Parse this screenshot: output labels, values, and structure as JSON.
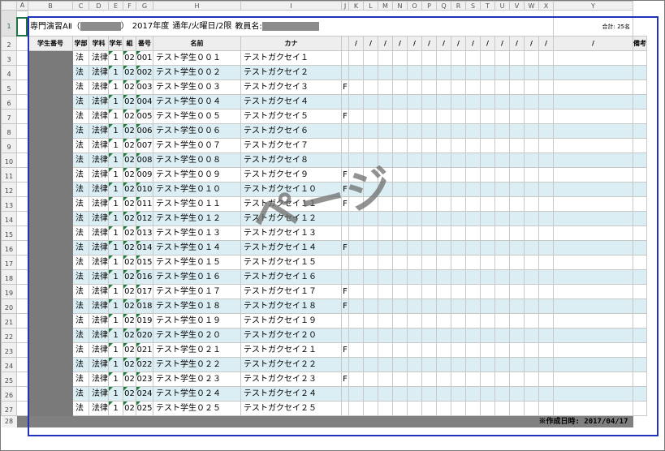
{
  "column_letters": [
    "A",
    "B",
    "C",
    "D",
    "E",
    "F",
    "G",
    "H",
    "I",
    "J",
    "K",
    "L",
    "M",
    "N",
    "O",
    "P",
    "Q",
    "R",
    "S",
    "T",
    "U",
    "V",
    "W",
    "X",
    "Y"
  ],
  "title": {
    "course": "専門演習AⅡ（",
    "course_close": "）",
    "year": "2017年度",
    "schedule": "通年/火曜日/2限",
    "instructor_label": "教員名:",
    "total": "合計: 25名"
  },
  "headers": {
    "student_no": "学生番号",
    "faculty": "学部",
    "department": "学科",
    "grade": "学年",
    "class": "組",
    "number": "番号",
    "name": "名前",
    "kana": "カナ",
    "date_slash": "/",
    "remarks": "備考"
  },
  "students": [
    {
      "faculty": "法",
      "dept": "法律",
      "grade": "1",
      "cls": "02",
      "no": "001",
      "name": "テスト学生００１",
      "kana": "テストガクセイ１",
      "flag": ""
    },
    {
      "faculty": "法",
      "dept": "法律",
      "grade": "1",
      "cls": "02",
      "no": "002",
      "name": "テスト学生００２",
      "kana": "テストガクセイ２",
      "flag": ""
    },
    {
      "faculty": "法",
      "dept": "法律",
      "grade": "1",
      "cls": "02",
      "no": "003",
      "name": "テスト学生００３",
      "kana": "テストガクセイ３",
      "flag": "F"
    },
    {
      "faculty": "法",
      "dept": "法律",
      "grade": "1",
      "cls": "02",
      "no": "004",
      "name": "テスト学生００４",
      "kana": "テストガクセイ４",
      "flag": ""
    },
    {
      "faculty": "法",
      "dept": "法律",
      "grade": "1",
      "cls": "02",
      "no": "005",
      "name": "テスト学生００５",
      "kana": "テストガクセイ５",
      "flag": "F"
    },
    {
      "faculty": "法",
      "dept": "法律",
      "grade": "1",
      "cls": "02",
      "no": "006",
      "name": "テスト学生００６",
      "kana": "テストガクセイ６",
      "flag": ""
    },
    {
      "faculty": "法",
      "dept": "法律",
      "grade": "1",
      "cls": "02",
      "no": "007",
      "name": "テスト学生００７",
      "kana": "テストガクセイ７",
      "flag": ""
    },
    {
      "faculty": "法",
      "dept": "法律",
      "grade": "1",
      "cls": "02",
      "no": "008",
      "name": "テスト学生００８",
      "kana": "テストガクセイ８",
      "flag": ""
    },
    {
      "faculty": "法",
      "dept": "法律",
      "grade": "1",
      "cls": "02",
      "no": "009",
      "name": "テスト学生００９",
      "kana": "テストガクセイ９",
      "flag": "F"
    },
    {
      "faculty": "法",
      "dept": "法律",
      "grade": "1",
      "cls": "02",
      "no": "010",
      "name": "テスト学生０１０",
      "kana": "テストガクセイ１０",
      "flag": "F"
    },
    {
      "faculty": "法",
      "dept": "法律",
      "grade": "1",
      "cls": "02",
      "no": "011",
      "name": "テスト学生０１１",
      "kana": "テストガクセイ１１",
      "flag": "F"
    },
    {
      "faculty": "法",
      "dept": "法律",
      "grade": "1",
      "cls": "02",
      "no": "012",
      "name": "テスト学生０１２",
      "kana": "テストガクセイ１２",
      "flag": ""
    },
    {
      "faculty": "法",
      "dept": "法律",
      "grade": "1",
      "cls": "02",
      "no": "013",
      "name": "テスト学生０１３",
      "kana": "テストガクセイ１３",
      "flag": ""
    },
    {
      "faculty": "法",
      "dept": "法律",
      "grade": "1",
      "cls": "02",
      "no": "014",
      "name": "テスト学生０１４",
      "kana": "テストガクセイ１４",
      "flag": "F"
    },
    {
      "faculty": "法",
      "dept": "法律",
      "grade": "1",
      "cls": "02",
      "no": "015",
      "name": "テスト学生０１５",
      "kana": "テストガクセイ１５",
      "flag": ""
    },
    {
      "faculty": "法",
      "dept": "法律",
      "grade": "1",
      "cls": "02",
      "no": "016",
      "name": "テスト学生０１６",
      "kana": "テストガクセイ１６",
      "flag": ""
    },
    {
      "faculty": "法",
      "dept": "法律",
      "grade": "1",
      "cls": "02",
      "no": "017",
      "name": "テスト学生０１７",
      "kana": "テストガクセイ１７",
      "flag": "F"
    },
    {
      "faculty": "法",
      "dept": "法律",
      "grade": "1",
      "cls": "02",
      "no": "018",
      "name": "テスト学生０１８",
      "kana": "テストガクセイ１８",
      "flag": "F"
    },
    {
      "faculty": "法",
      "dept": "法律",
      "grade": "1",
      "cls": "02",
      "no": "019",
      "name": "テスト学生０１９",
      "kana": "テストガクセイ１９",
      "flag": ""
    },
    {
      "faculty": "法",
      "dept": "法律",
      "grade": "1",
      "cls": "02",
      "no": "020",
      "name": "テスト学生０２０",
      "kana": "テストガクセイ２０",
      "flag": ""
    },
    {
      "faculty": "法",
      "dept": "法律",
      "grade": "1",
      "cls": "02",
      "no": "021",
      "name": "テスト学生０２１",
      "kana": "テストガクセイ２１",
      "flag": "F"
    },
    {
      "faculty": "法",
      "dept": "法律",
      "grade": "1",
      "cls": "02",
      "no": "022",
      "name": "テスト学生０２２",
      "kana": "テストガクセイ２２",
      "flag": ""
    },
    {
      "faculty": "法",
      "dept": "法律",
      "grade": "1",
      "cls": "02",
      "no": "023",
      "name": "テスト学生０２３",
      "kana": "テストガクセイ２３",
      "flag": "F"
    },
    {
      "faculty": "法",
      "dept": "法律",
      "grade": "1",
      "cls": "02",
      "no": "024",
      "name": "テスト学生０２４",
      "kana": "テストガクセイ２４",
      "flag": ""
    },
    {
      "faculty": "法",
      "dept": "法律",
      "grade": "1",
      "cls": "02",
      "no": "025",
      "name": "テスト学生０２５",
      "kana": "テストガクセイ２５",
      "flag": ""
    }
  ],
  "watermark": "ページ",
  "footer": {
    "created": "※作成日時: 2017/04/17"
  },
  "colors": {
    "band": "#daeef3",
    "print_area_border": "#2233bb",
    "selection": "#217346",
    "redaction": "#8c8c8c"
  }
}
